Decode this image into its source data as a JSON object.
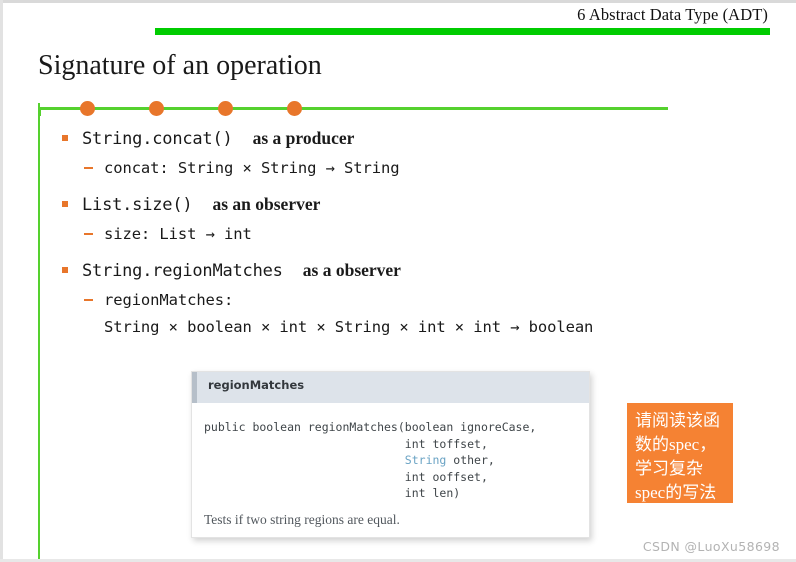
{
  "header": {
    "chapter": "6 Abstract Data Type (ADT)"
  },
  "title": "Signature of an operation",
  "decor": {
    "dot_color": "#e8762b",
    "line_color": "#55d12e",
    "bar_color": "#00cc00",
    "dot_count": 4
  },
  "bullets": [
    {
      "code": "String.concat()",
      "desc": "as a producer",
      "sub_code": "concat:",
      "sub_sig": "String × String → String"
    },
    {
      "code": "List.size()",
      "desc": "as an observer",
      "sub_code": "size:",
      "sub_sig": "List → int"
    },
    {
      "code": "String.regionMatches",
      "desc": "as a observer",
      "sub_code": "regionMatches:",
      "sub_sig": "String × boolean × int × String × int × int → boolean"
    }
  ],
  "doc_box": {
    "method_name": "regionMatches",
    "signature_line1": "public boolean regionMatches(boolean ignoreCase,",
    "signature_line2_indent": "                             ",
    "signature_line2": "int toffset,",
    "signature_line3": "String",
    "signature_line3_rest": " other,",
    "signature_line4": "int ooffset,",
    "signature_line5": "int len)",
    "description": "Tests if two string regions are equal.",
    "link_color": "#6aa3c4",
    "header_bg": "#dde3ea"
  },
  "note": {
    "line1": "请阅读该函",
    "line2": "数的spec，",
    "line3": "学习复杂",
    "line4": "spec的写法",
    "bg_color": "#f58233"
  },
  "watermark": "CSDN @LuoXu58698"
}
